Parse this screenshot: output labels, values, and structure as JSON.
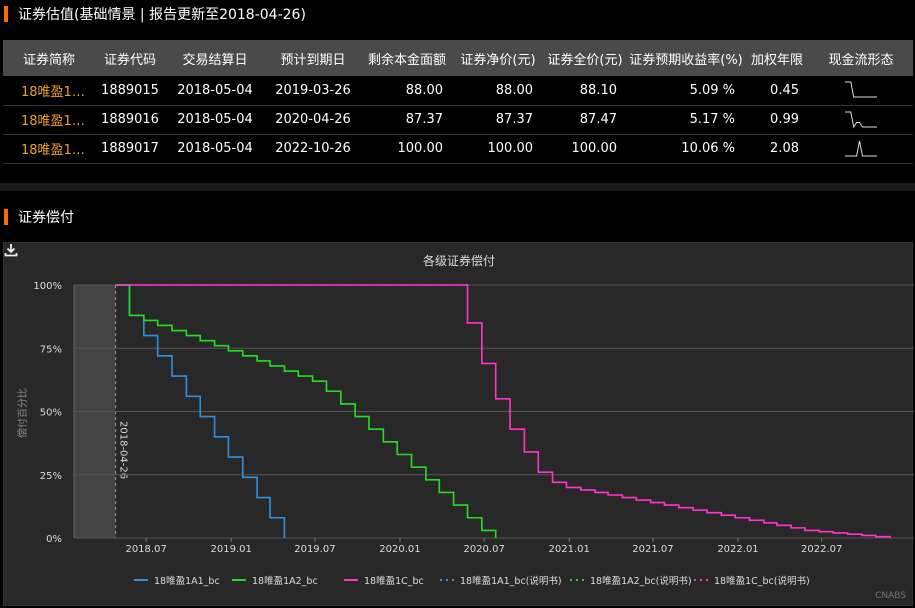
{
  "valuation": {
    "title": "证券估值(基础情景 | 报告更新至2018-04-26)",
    "headers": [
      "证券简称",
      "证券代码",
      "交易结算日",
      "预计到期日",
      "剩余本金面额",
      "证券净价(元)",
      "证券全价(元)",
      "证券预期收益率(%)",
      "加权年限",
      "现金流形态"
    ],
    "rows": [
      {
        "name": "18唯盈1A...",
        "code": "1889015",
        "settle": "2018-05-04",
        "maturity": "2019-03-26",
        "principal": "88.00",
        "net": "88.00",
        "full": "88.10",
        "yield": "5.09 %",
        "wal": "0.45",
        "spark": [
          0,
          0,
          0,
          1,
          1,
          1,
          1,
          1,
          1,
          1,
          1,
          1
        ]
      },
      {
        "name": "18唯盈1A...",
        "code": "1889016",
        "settle": "2018-05-04",
        "maturity": "2020-04-26",
        "principal": "87.37",
        "net": "87.37",
        "full": "87.47",
        "yield": "5.17 %",
        "wal": "0.99",
        "spark": [
          0,
          0,
          0,
          1,
          0.7,
          0.7,
          1,
          1,
          1,
          1,
          1,
          1
        ]
      },
      {
        "name": "18唯盈1C_...",
        "code": "1889017",
        "settle": "2018-05-04",
        "maturity": "2022-10-26",
        "principal": "100.00",
        "net": "100.00",
        "full": "100.00",
        "yield": "10.06 %",
        "wal": "2.08",
        "spark": [
          1,
          1,
          1,
          1,
          1,
          0,
          1,
          1,
          1,
          1,
          1,
          1
        ]
      }
    ]
  },
  "payment": {
    "title": "证券偿付"
  },
  "chart_data": {
    "type": "line",
    "title": "各级证券偿付",
    "ylabel": "偿付百分比",
    "xlabel": "",
    "x_ticks": [
      "2018.07",
      "2019.01",
      "2019.07",
      "2020.01",
      "2020.07",
      "2021.01",
      "2021.07",
      "2022.01",
      "2022.07"
    ],
    "x_range": [
      "2018-01-26",
      "2022-12-26"
    ],
    "y_ticks": [
      "0%",
      "25%",
      "50%",
      "75%",
      "100%"
    ],
    "ylim": [
      0,
      100
    ],
    "shaded_until": "2018-04-26",
    "vline_label": "2018-04-26",
    "legend_position": "bottom",
    "series": [
      {
        "name": "18唯盈1A1_bc",
        "color": "#2e8fe0",
        "style": "solid",
        "points": [
          [
            "2018-04-26",
            100
          ],
          [
            "2018-05-26",
            88
          ],
          [
            "2018-06-26",
            80
          ],
          [
            "2018-07-26",
            72
          ],
          [
            "2018-08-26",
            64
          ],
          [
            "2018-09-26",
            56
          ],
          [
            "2018-10-26",
            48
          ],
          [
            "2018-11-26",
            40
          ],
          [
            "2018-12-26",
            32
          ],
          [
            "2019-01-26",
            24
          ],
          [
            "2019-02-26",
            16
          ],
          [
            "2019-03-26",
            8
          ],
          [
            "2019-04-26",
            0
          ]
        ]
      },
      {
        "name": "18唯盈1A2_bc",
        "color": "#22dd22",
        "style": "solid",
        "points": [
          [
            "2018-04-26",
            100
          ],
          [
            "2018-05-26",
            88
          ],
          [
            "2018-06-26",
            86
          ],
          [
            "2018-07-26",
            84
          ],
          [
            "2018-08-26",
            82
          ],
          [
            "2018-09-26",
            80
          ],
          [
            "2018-10-26",
            78
          ],
          [
            "2018-11-26",
            76
          ],
          [
            "2018-12-26",
            74
          ],
          [
            "2019-01-26",
            72
          ],
          [
            "2019-02-26",
            70
          ],
          [
            "2019-03-26",
            68
          ],
          [
            "2019-04-26",
            66
          ],
          [
            "2019-05-26",
            64
          ],
          [
            "2019-06-26",
            62
          ],
          [
            "2019-07-26",
            58
          ],
          [
            "2019-08-26",
            53
          ],
          [
            "2019-09-26",
            48
          ],
          [
            "2019-10-26",
            43
          ],
          [
            "2019-11-26",
            38
          ],
          [
            "2019-12-26",
            33
          ],
          [
            "2020-01-26",
            28
          ],
          [
            "2020-02-26",
            23
          ],
          [
            "2020-03-26",
            18
          ],
          [
            "2020-04-26",
            13
          ],
          [
            "2020-05-26",
            8
          ],
          [
            "2020-06-26",
            3
          ],
          [
            "2020-07-26",
            0
          ]
        ]
      },
      {
        "name": "18唯盈1C_bc",
        "color": "#ff33cc",
        "style": "solid",
        "points": [
          [
            "2018-04-26",
            100
          ],
          [
            "2020-04-26",
            100
          ],
          [
            "2020-05-26",
            85
          ],
          [
            "2020-06-26",
            69
          ],
          [
            "2020-07-26",
            55
          ],
          [
            "2020-08-26",
            43
          ],
          [
            "2020-09-26",
            34
          ],
          [
            "2020-10-26",
            26
          ],
          [
            "2020-11-26",
            22
          ],
          [
            "2020-12-26",
            20
          ],
          [
            "2021-01-26",
            19
          ],
          [
            "2021-02-26",
            18
          ],
          [
            "2021-03-26",
            17
          ],
          [
            "2021-04-26",
            16
          ],
          [
            "2021-05-26",
            15
          ],
          [
            "2021-06-26",
            14
          ],
          [
            "2021-07-26",
            13
          ],
          [
            "2021-08-26",
            12
          ],
          [
            "2021-09-26",
            11
          ],
          [
            "2021-10-26",
            10
          ],
          [
            "2021-11-26",
            9
          ],
          [
            "2021-12-26",
            8
          ],
          [
            "2022-01-26",
            7
          ],
          [
            "2022-02-26",
            6
          ],
          [
            "2022-03-26",
            5
          ],
          [
            "2022-04-26",
            4
          ],
          [
            "2022-05-26",
            3
          ],
          [
            "2022-06-26",
            2.5
          ],
          [
            "2022-07-26",
            2
          ],
          [
            "2022-08-26",
            1.5
          ],
          [
            "2022-09-26",
            1
          ],
          [
            "2022-10-26",
            0.5
          ],
          [
            "2022-11-26",
            0
          ]
        ]
      },
      {
        "name": "18唯盈1A1_bc(说明书)",
        "color": "#2e8fe0",
        "style": "dotted",
        "ref": 0
      },
      {
        "name": "18唯盈1A2_bc(说明书)",
        "color": "#22dd22",
        "style": "dotted",
        "ref": 1
      },
      {
        "name": "18唯盈1C_bc(说明书)",
        "color": "#ff33cc",
        "style": "dotted",
        "ref": 2
      }
    ]
  },
  "footer": {
    "brand": "CNABS"
  }
}
